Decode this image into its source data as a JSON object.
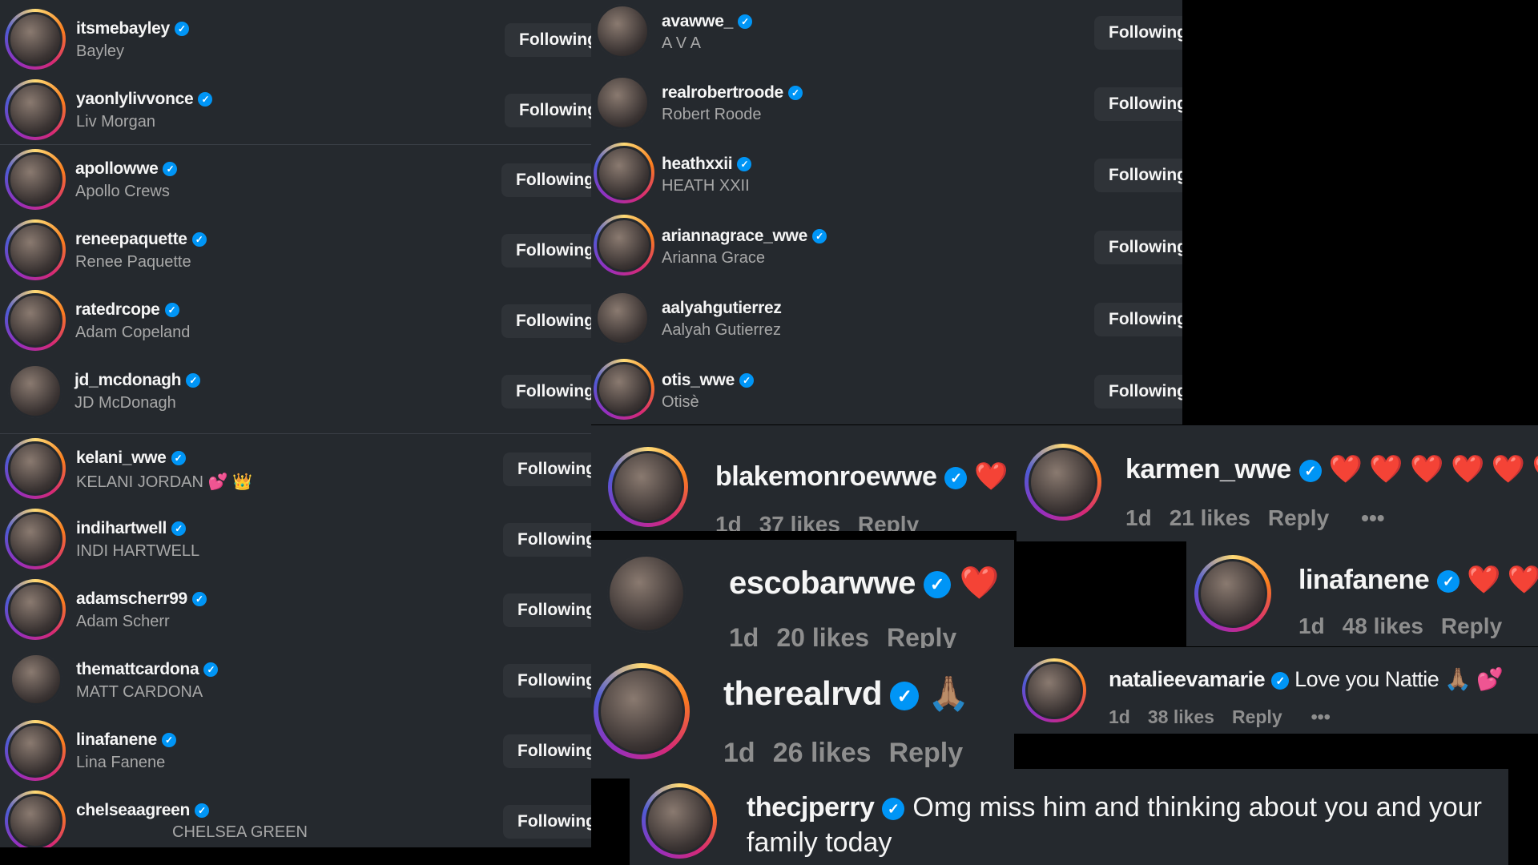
{
  "follow_label": "Following",
  "left_list": [
    {
      "username": "itsmebayley",
      "name": "Bayley",
      "verified": true
    },
    {
      "username": "yaonlylivvonce",
      "name": "Liv Morgan",
      "verified": true
    },
    {
      "username": "apollowwe",
      "name": "Apollo Crews",
      "verified": true
    },
    {
      "username": "reneepaquette",
      "name": "Renee Paquette",
      "verified": true
    },
    {
      "username": "ratedrcope",
      "name": "Adam Copeland",
      "verified": true
    },
    {
      "username": "jd_mcdonagh",
      "name": "JD McDonagh",
      "verified": true
    },
    {
      "username": "kelani_wwe",
      "name": "KELANI JORDAN 💕 👑",
      "verified": true
    },
    {
      "username": "indihartwell",
      "name": "INDI HARTWELL",
      "verified": true
    },
    {
      "username": "adamscherr99",
      "name": "Adam Scherr",
      "verified": true
    },
    {
      "username": "themattcardona",
      "name": "MATT CARDONA",
      "verified": true
    },
    {
      "username": "linafanene",
      "name": "Lina Fanene",
      "verified": true
    },
    {
      "username": "chelseaagreen",
      "name": "CHELSEA GREEN",
      "verified": true
    }
  ],
  "right_list": [
    {
      "username": "avawwe_",
      "name": "A V A",
      "verified": true
    },
    {
      "username": "realrobertroode",
      "name": "Robert Roode",
      "verified": true
    },
    {
      "username": "heathxxii",
      "name": "HEATH XXII",
      "verified": true
    },
    {
      "username": "ariannagrace_wwe",
      "name": "Arianna Grace",
      "verified": true
    },
    {
      "username": "aalyahgutierrez",
      "name": "Aalyah Gutierrez",
      "verified": false
    },
    {
      "username": "otis_wwe",
      "name": "Otisè",
      "verified": true
    }
  ],
  "comments": [
    {
      "username": "blakemonroewwe",
      "text": "❤️",
      "time": "1d",
      "likes": "37 likes",
      "reply": "Reply"
    },
    {
      "username": "karmen_wwe",
      "text": "❤️ ❤️ ❤️ ❤️ ❤️ ❤️",
      "time": "1d",
      "likes": "21 likes",
      "reply": "Reply",
      "more": "•••"
    },
    {
      "username": "escobarwwe",
      "text": "❤️",
      "time": "1d",
      "likes": "20 likes",
      "reply": "Reply"
    },
    {
      "username": "linafanene",
      "text": "❤️ ❤️",
      "time": "1d",
      "likes": "48 likes",
      "reply": "Reply"
    },
    {
      "username": "therealrvd",
      "text": "🙏🏽",
      "time": "1d",
      "likes": "26 likes",
      "reply": "Reply"
    },
    {
      "username": "natalieevamarie",
      "text": "Love you Nattie 🙏🏽 💕",
      "time": "1d",
      "likes": "38 likes",
      "reply": "Reply",
      "more": "•••"
    },
    {
      "username": "thecjperry",
      "text": "Omg miss him and thinking about you and your family today"
    }
  ],
  "colors": {
    "panel": "#25292e",
    "verified": "#0095f6",
    "heart": "#ff3040",
    "muted": "#8e8e8e"
  }
}
